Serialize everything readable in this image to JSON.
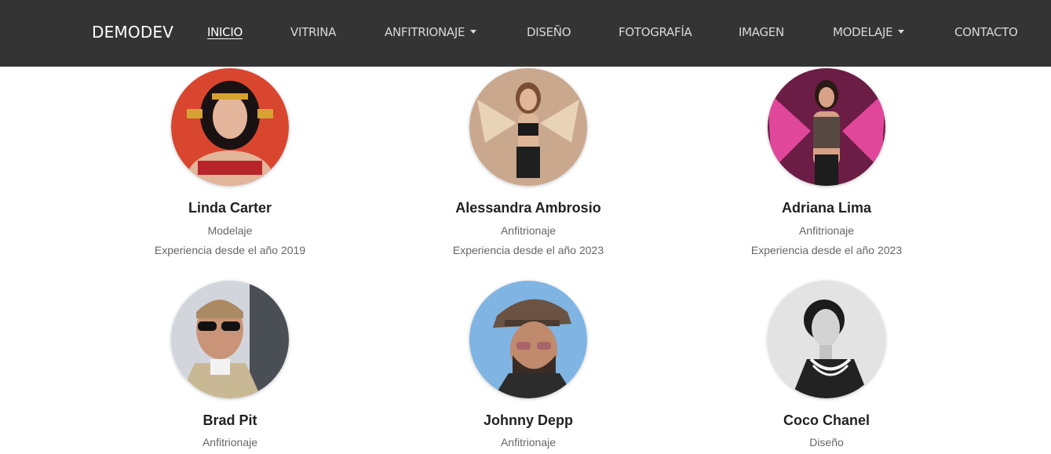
{
  "navbar": {
    "brand": "DEMODEV",
    "links": [
      {
        "label": "INICIO",
        "active": true,
        "dropdown": false
      },
      {
        "label": "VITRINA",
        "active": false,
        "dropdown": false
      },
      {
        "label": "ANFITRIONAJE",
        "active": false,
        "dropdown": true
      },
      {
        "label": "DISEÑO",
        "active": false,
        "dropdown": false
      },
      {
        "label": "FOTOGRAFÍA",
        "active": false,
        "dropdown": false
      },
      {
        "label": "IMAGEN",
        "active": false,
        "dropdown": false
      },
      {
        "label": "MODELAJE",
        "active": false,
        "dropdown": true
      },
      {
        "label": "CONTACTO",
        "active": false,
        "dropdown": false
      }
    ]
  },
  "profiles": [
    {
      "name": "Linda Carter",
      "category": "Modelaje",
      "experience": "Experiencia desde el año 2019"
    },
    {
      "name": "Alessandra Ambrosio",
      "category": "Anfitrionaje",
      "experience": "Experiencia desde el año 2023"
    },
    {
      "name": "Adriana Lima",
      "category": "Anfitrionaje",
      "experience": "Experiencia desde el año 2023"
    },
    {
      "name": "Brad Pit",
      "category": "Anfitrionaje",
      "experience": ""
    },
    {
      "name": "Johnny Depp",
      "category": "Anfitrionaje",
      "experience": ""
    },
    {
      "name": "Coco Chanel",
      "category": "Diseño",
      "experience": ""
    }
  ],
  "colors": {
    "navbar_bg": "#343434",
    "nav_text": "#d8d8d8",
    "name_text": "#222222",
    "meta_text": "#666666"
  }
}
